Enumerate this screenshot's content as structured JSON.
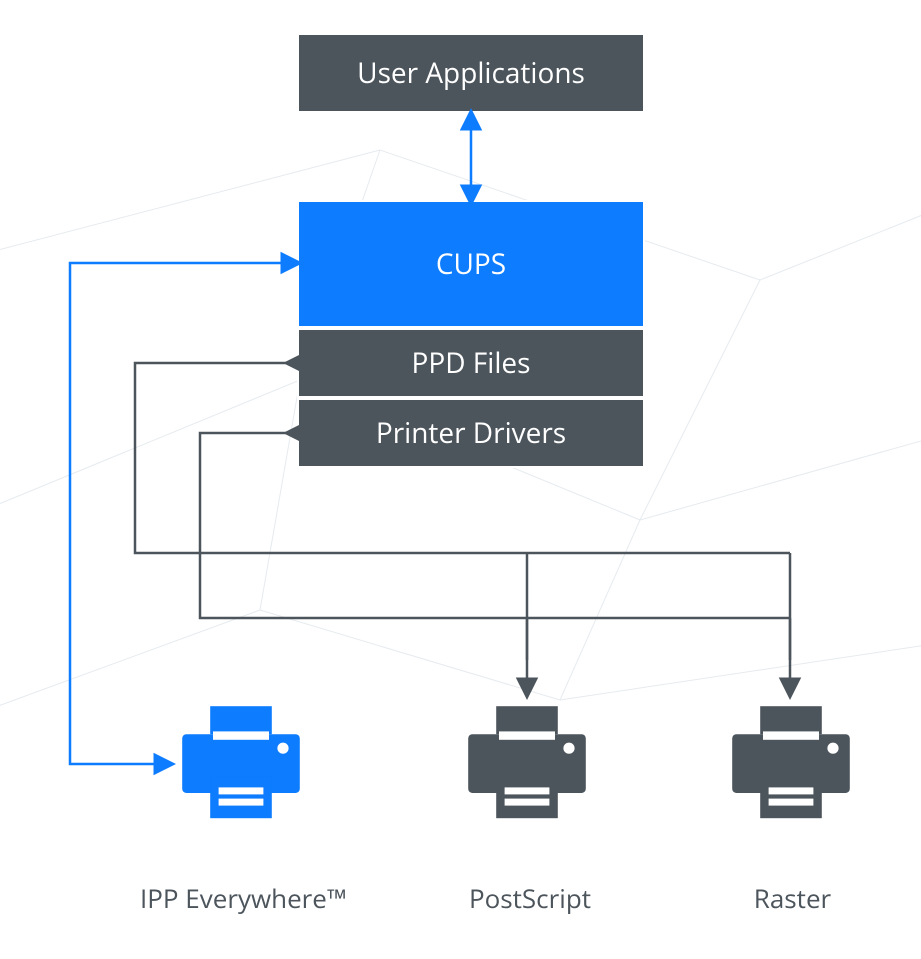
{
  "diagram": {
    "boxes": {
      "user_apps": "User Applications",
      "cups": "CUPS",
      "ppd": "PPD Files",
      "drivers": "Printer Drivers"
    },
    "printers": {
      "ipp": {
        "label": "IPP Everywhere™",
        "style": "accent"
      },
      "ps": {
        "label": "PostScript",
        "style": "gray"
      },
      "raster": {
        "label": "Raster",
        "style": "gray"
      }
    },
    "connectors": [
      {
        "from": "user_apps",
        "to": "cups",
        "dir": "both",
        "style": "accent"
      },
      {
        "from": "cups",
        "to": "ipp",
        "dir": "both",
        "style": "accent"
      },
      {
        "from": "ppd",
        "to": "ps",
        "dir": "to",
        "style": "gray"
      },
      {
        "from": "ppd",
        "to": "raster",
        "dir": "to",
        "style": "gray"
      },
      {
        "from": "drivers",
        "to": "ps",
        "dir": "to",
        "style": "gray"
      },
      {
        "from": "drivers",
        "to": "raster",
        "dir": "to",
        "style": "gray"
      }
    ],
    "colors": {
      "accent": "#0d7cff",
      "box_dark": "#4c555c",
      "arrow_gray": "#4c555c",
      "bg_mesh": "#e9eef2"
    },
    "description": "Architecture diagram of the CUPS printing system. User Applications talk to CUPS (bidirectional). CUPS communicates directly with IPP Everywhere printers. PPD Files and Printer Drivers feed PostScript and Raster printers."
  }
}
